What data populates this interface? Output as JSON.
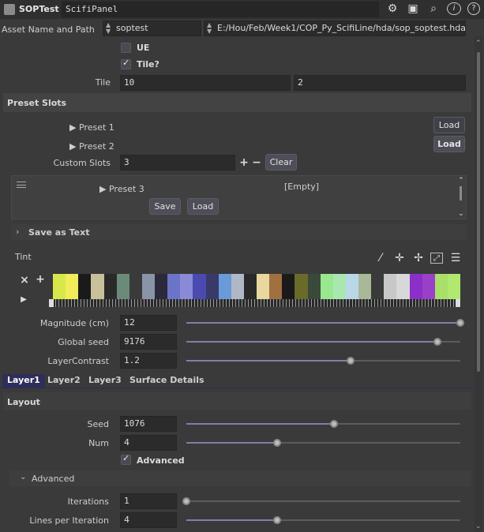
{
  "header": {
    "node_type": "SOPTest",
    "node_name": "ScifiPanel"
  },
  "asset": {
    "label": "Asset Name and Path",
    "name": "soptest",
    "path": "E:/Hou/Feb/Week1/COP_Py_ScifiLine/hda/sop_soptest.hda"
  },
  "ue": {
    "label": "UE",
    "checked": false
  },
  "tile_toggle": {
    "label": "Tile?",
    "checked": true
  },
  "tile": {
    "label": "Tile",
    "x": "10",
    "y": "2"
  },
  "preset_slots": {
    "title": "Preset Slots",
    "preset1": "Preset 1",
    "preset2": "Preset 2",
    "load1": "Load",
    "load2": "Load",
    "custom_label": "Custom Slots",
    "custom_value": "3",
    "clear": "Clear",
    "preset3": "Preset 3",
    "empty": "[Empty]",
    "save": "Save",
    "load3": "Load",
    "save_as_text": "Save as Text"
  },
  "tint": {
    "label": "Tint",
    "ramp_colors": [
      "#d8e84a",
      "#f0ec5a",
      "#1a1a1a",
      "#c8c098",
      "#2a2a2a",
      "#6a8a7a",
      "#3a3a3a",
      "#8a94a8",
      "#2a2a3a",
      "#6a74c8",
      "#8a8ad8",
      "#4a4ab0",
      "#3a3a6a",
      "#6a9ad8",
      "#b0b8c8",
      "#2a2a2a",
      "#e8d8a0",
      "#a07040",
      "#1a1a1a",
      "#6a6a2a",
      "#3a4a3a",
      "#98e890",
      "#a8e8b0",
      "#b8d8e8",
      "#a8b898",
      "#3a3a3a",
      "#c8c8c8",
      "#d8d8d8",
      "#8a30c8",
      "#9a40c8",
      "#a8e06a",
      "#b0e870"
    ]
  },
  "magnitude": {
    "label": "Magnitude (cm)",
    "value": "12",
    "fraction": 1.0
  },
  "global_seed": {
    "label": "Global seed",
    "value": "9176",
    "fraction": 0.917
  },
  "layer_contrast": {
    "label": "LayerContrast",
    "value": "1.2",
    "fraction": 0.6
  },
  "tabs": [
    "Layer1",
    "Layer2",
    "Layer3",
    "Surface Details"
  ],
  "layout": {
    "title": "Layout",
    "seed_label": "Seed",
    "seed_value": "1076",
    "seed_fraction": 0.54,
    "num_label": "Num",
    "num_value": "4",
    "num_fraction": 0.33,
    "advanced_label": "Advanced",
    "advanced_checked": true
  },
  "advanced": {
    "title": "Advanced",
    "iterations_label": "Iterations",
    "iterations_value": "1",
    "iterations_fraction": 0.0,
    "lines_label": "Lines per Iteration",
    "lines_value": "4",
    "lines_fraction": 0.33
  },
  "icons": [
    "gear-icon",
    "bucket-icon",
    "search-icon",
    "info-icon",
    "help-icon"
  ]
}
